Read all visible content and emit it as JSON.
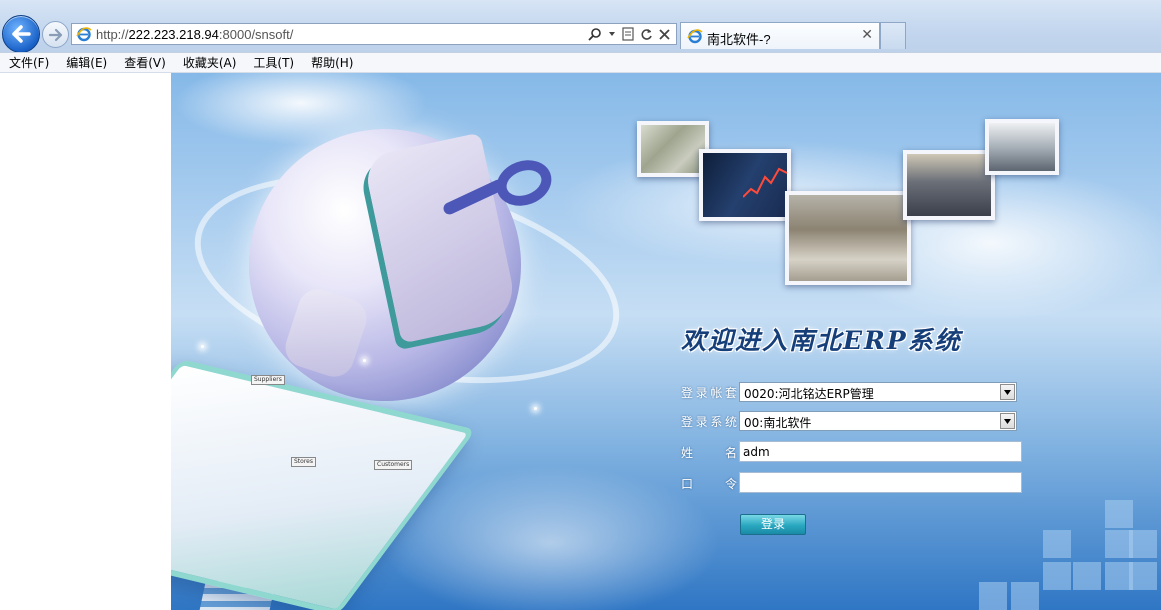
{
  "browser": {
    "address_url_prefix": "http://",
    "address_url_host": "222.223.218.94",
    "address_url_suffix": ":8000/snsoft/",
    "tab_title": "南北软件-?",
    "tab_close": "✕",
    "icons": {
      "back": "back-arrow-icon",
      "forward": "forward-arrow-icon",
      "search": "search-icon",
      "refresh": "refresh-icon",
      "stop": "stop-icon",
      "page_icon": "ie-logo-icon"
    }
  },
  "menubar": {
    "items": [
      "文件(F)",
      "编辑(E)",
      "查看(V)",
      "收藏夹(A)",
      "工具(T)",
      "帮助(H)"
    ]
  },
  "login": {
    "welcome": "欢迎进入南北ERP系统",
    "account_label": "登录帐套",
    "account_value": "0020:河北铭达ERP管理",
    "system_label": "登录系统",
    "system_value": "00:南北软件",
    "name_label": "姓 名",
    "name_value": "adm",
    "password_label": "口 令",
    "password_value": "",
    "login_button": "登录"
  },
  "illustration": {
    "labels": [
      "Suppliers",
      "Customers",
      "Stores"
    ]
  },
  "colors": {
    "chrome_bg": "#c3d6ee",
    "welcome_text": "#163f7a",
    "login_button": "#29a8c0"
  }
}
